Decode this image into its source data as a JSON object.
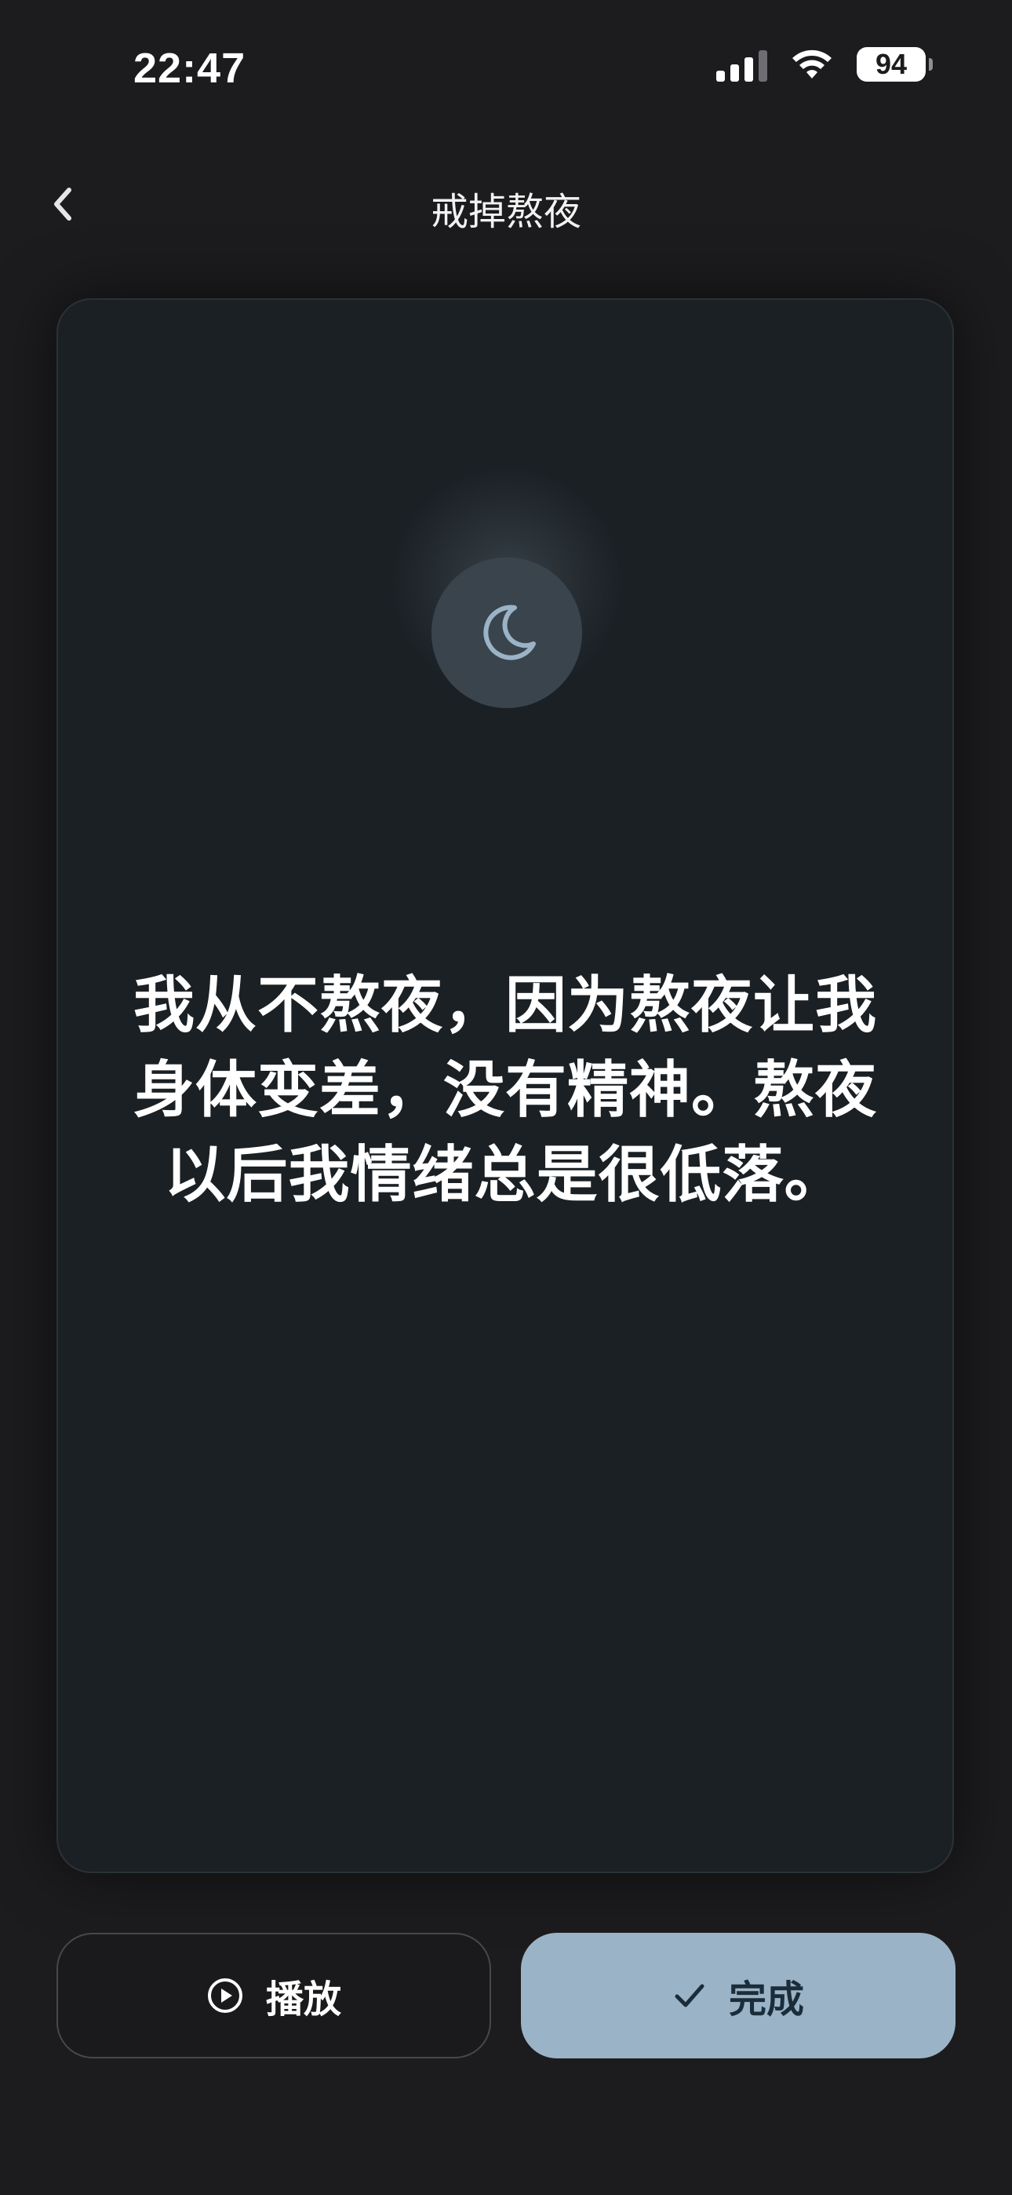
{
  "status_bar": {
    "time": "22:47",
    "battery": "94"
  },
  "nav": {
    "title": "戒掉熬夜"
  },
  "card": {
    "icon": "moon-icon",
    "text": "我从不熬夜，因为熬夜让我身体变差，没有精神。熬夜以后我情绪总是很低落。"
  },
  "actions": {
    "play_label": "播放",
    "done_label": "完成"
  },
  "colors": {
    "background": "#1c1c1e",
    "card": "#1a2024",
    "accent": "#9bb3c7",
    "moon": "#9bb3c7"
  }
}
